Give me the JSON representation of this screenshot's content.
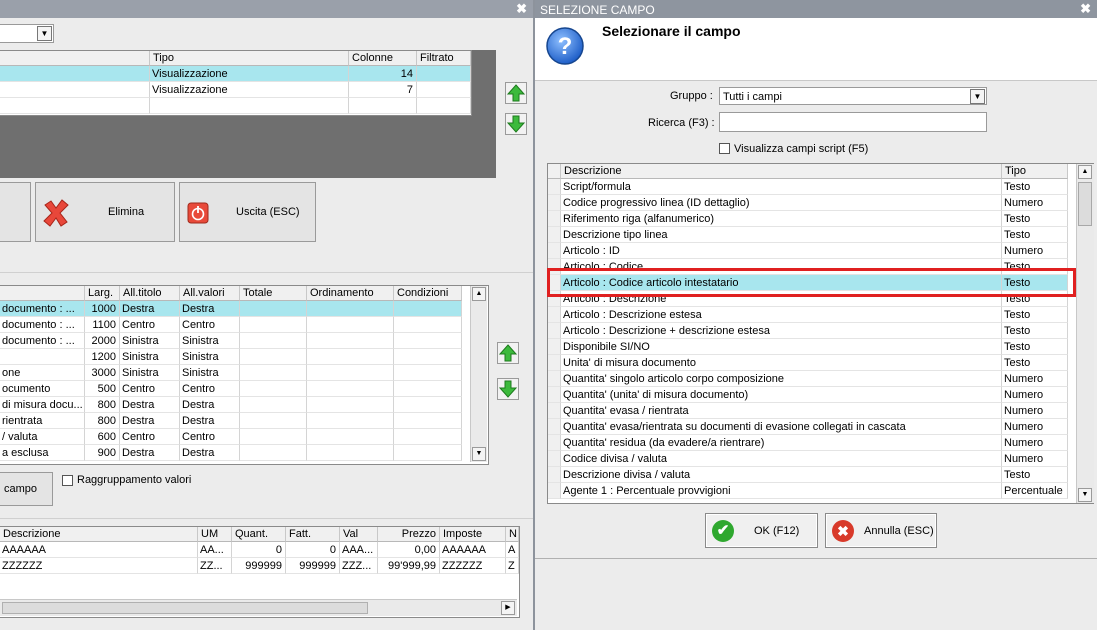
{
  "background_window": {
    "close_glyph": "✖",
    "views_table": {
      "headers": [
        "Tipo",
        "Colonne",
        "Filtrato"
      ],
      "rows": [
        {
          "tipo": "Visualizzazione",
          "colonne": "14",
          "filtrato": ""
        },
        {
          "tipo": "Visualizzazione",
          "colonne": "7",
          "filtrato": ""
        }
      ]
    },
    "buttons": {
      "delete_label": "Elimina",
      "exit_label": "Uscita (ESC)",
      "add_field_label": "campo"
    },
    "fields_table": {
      "headers": [
        "Larg.",
        "All.titolo",
        "All.valori",
        "Totale",
        "Ordinamento",
        "Condizioni"
      ],
      "rows": [
        {
          "name": "documento : ...",
          "larg": "1000",
          "titolo": "Destra",
          "valori": "Destra"
        },
        {
          "name": "documento : ...",
          "larg": "1100",
          "titolo": "Centro",
          "valori": "Centro"
        },
        {
          "name": "documento : ...",
          "larg": "2000",
          "titolo": "Sinistra",
          "valori": "Sinistra"
        },
        {
          "name": "",
          "larg": "1200",
          "titolo": "Sinistra",
          "valori": "Sinistra"
        },
        {
          "name": "one",
          "larg": "3000",
          "titolo": "Sinistra",
          "valori": "Sinistra"
        },
        {
          "name": "ocumento",
          "larg": "500",
          "titolo": "Centro",
          "valori": "Centro"
        },
        {
          "name": "di misura docu...",
          "larg": "800",
          "titolo": "Destra",
          "valori": "Destra"
        },
        {
          "name": "rientrata",
          "larg": "800",
          "titolo": "Destra",
          "valori": "Destra"
        },
        {
          "name": "/ valuta",
          "larg": "600",
          "titolo": "Centro",
          "valori": "Centro"
        },
        {
          "name": "a esclusa",
          "larg": "900",
          "titolo": "Destra",
          "valori": "Destra"
        }
      ]
    },
    "grouping_checkbox_label": "Raggruppamento valori",
    "preview_table": {
      "headers": [
        "Descrizione",
        "UM",
        "Quant.",
        "Fatt.",
        "Val",
        "Prezzo",
        "Imposte",
        "N."
      ],
      "rows": [
        [
          "AAAAAA",
          "AA...",
          "0",
          "0",
          "AAA...",
          "0,00",
          "AAAAAA",
          "A"
        ],
        [
          "ZZZZZZ",
          "ZZ...",
          "999999",
          "999999",
          "ZZZ...",
          "99'999,99",
          "ZZZZZZ",
          "Z"
        ]
      ]
    }
  },
  "dialog": {
    "title": "SELEZIONE CAMPO",
    "close_glyph": "✖",
    "heading": "Selezionare il campo",
    "help_icon_glyph": "?",
    "gruppo_label": "Gruppo :",
    "gruppo_value": "Tutti i campi",
    "ricerca_label": "Ricerca (F3) :",
    "ricerca_value": "",
    "script_checkbox_label": "Visualizza campi script (F5)",
    "table": {
      "headers": [
        "Descrizione",
        "Tipo"
      ],
      "selected_index": 6,
      "rows": [
        {
          "descrizione": "Script/formula",
          "tipo": "Testo"
        },
        {
          "descrizione": "Codice progressivo linea (ID dettaglio)",
          "tipo": "Numero"
        },
        {
          "descrizione": "Riferimento riga (alfanumerico)",
          "tipo": "Testo"
        },
        {
          "descrizione": "Descrizione tipo linea",
          "tipo": "Testo"
        },
        {
          "descrizione": "Articolo : ID",
          "tipo": "Numero"
        },
        {
          "descrizione": "Articolo : Codice",
          "tipo": "Testo"
        },
        {
          "descrizione": "Articolo : Codice articolo intestatario",
          "tipo": "Testo"
        },
        {
          "descrizione": "Articolo : Descrizione",
          "tipo": "Testo"
        },
        {
          "descrizione": "Articolo : Descrizione estesa",
          "tipo": "Testo"
        },
        {
          "descrizione": "Articolo : Descrizione + descrizione estesa",
          "tipo": "Testo"
        },
        {
          "descrizione": "Disponibile SI/NO",
          "tipo": "Testo"
        },
        {
          "descrizione": "Unita' di misura documento",
          "tipo": "Testo"
        },
        {
          "descrizione": "Quantita' singolo articolo corpo composizione",
          "tipo": "Numero"
        },
        {
          "descrizione": "Quantita' (unita' di misura documento)",
          "tipo": "Numero"
        },
        {
          "descrizione": "Quantita' evasa / rientrata",
          "tipo": "Numero"
        },
        {
          "descrizione": "Quantita' evasa/rientrata su documenti di evasione collegati in cascata",
          "tipo": "Numero"
        },
        {
          "descrizione": "Quantita' residua (da evadere/a rientrare)",
          "tipo": "Numero"
        },
        {
          "descrizione": "Codice divisa / valuta",
          "tipo": "Numero"
        },
        {
          "descrizione": "Descrizione divisa / valuta",
          "tipo": "Testo"
        },
        {
          "descrizione": "Agente 1 : Percentuale provvigioni",
          "tipo": "Percentuale"
        }
      ]
    },
    "ok_label": "OK (F12)",
    "cancel_label": "Annulla (ESC)"
  },
  "colors": {
    "selection": "#a8e6ee",
    "highlight_box": "#e02020",
    "titlebar": "#8e959f",
    "ok_green": "#2fa82f",
    "cancel_red": "#d83a2a"
  }
}
